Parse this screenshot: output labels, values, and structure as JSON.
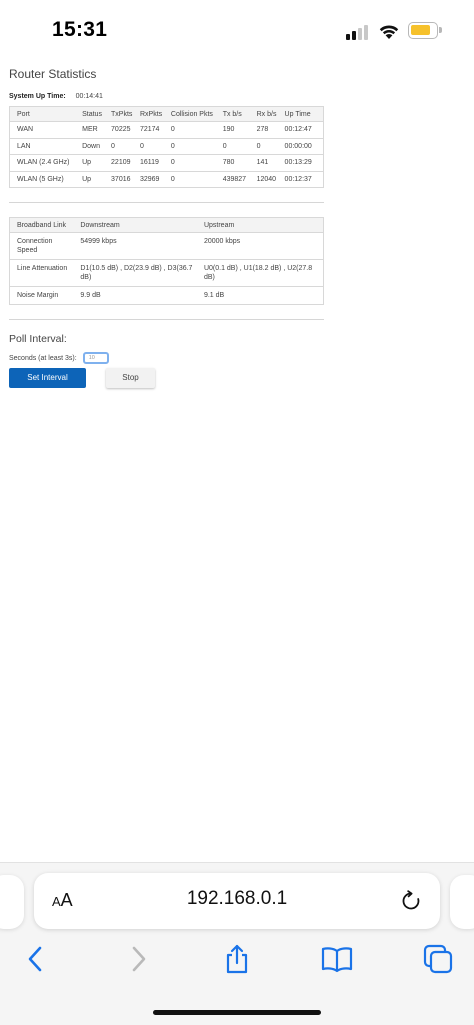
{
  "status_bar": {
    "time": "15:31"
  },
  "page": {
    "title": "Router Statistics",
    "uptime_label": "System Up Time:",
    "uptime_value": "00:14:41"
  },
  "stats_table": {
    "headers": [
      "Port",
      "Status",
      "TxPkts",
      "RxPkts",
      "Collision Pkts",
      "Tx b/s",
      "Rx b/s",
      "Up Time"
    ],
    "rows": [
      [
        "WAN",
        "MER",
        "70225",
        "72174",
        "0",
        "190",
        "278",
        "00:12:47"
      ],
      [
        "LAN",
        "Down",
        "0",
        "0",
        "0",
        "0",
        "0",
        "00:00:00"
      ],
      [
        "WLAN (2.4 GHz)",
        "Up",
        "22109",
        "16119",
        "0",
        "780",
        "141",
        "00:13:29"
      ],
      [
        "WLAN (5 GHz)",
        "Up",
        "37016",
        "32969",
        "0",
        "439827",
        "12040",
        "00:12:37"
      ]
    ]
  },
  "broadband_table": {
    "headers": [
      "Broadband Link",
      "Downstream",
      "Upstream"
    ],
    "rows": [
      [
        "Connection Speed",
        "54999 kbps",
        "20000 kbps"
      ],
      [
        "Line Attenuation",
        "D1(10.5 dB) , D2(23.9 dB) , D3(36.7 dB)",
        "U0(0.1 dB) , U1(18.2 dB) , U2(27.8 dB)"
      ],
      [
        "Noise Margin",
        "9.9 dB",
        "9.1 dB"
      ]
    ]
  },
  "poll": {
    "title": "Poll Interval:",
    "seconds_label": "Seconds (at least 3s):",
    "seconds_value": "10",
    "set_button": "Set Interval",
    "stop_button": "Stop"
  },
  "browser": {
    "aa_label_small": "A",
    "aa_label_large": "A",
    "url": "192.168.0.1",
    "icons": [
      "back-icon",
      "forward-icon",
      "share-icon",
      "bookmarks-icon",
      "tabs-icon",
      "reload-icon"
    ],
    "accent_color": "#1a73e8",
    "disabled_color": "#b9b9b9"
  },
  "colors": {
    "set_button_bg": "#0d64b8",
    "battery": "#f6c12b"
  }
}
